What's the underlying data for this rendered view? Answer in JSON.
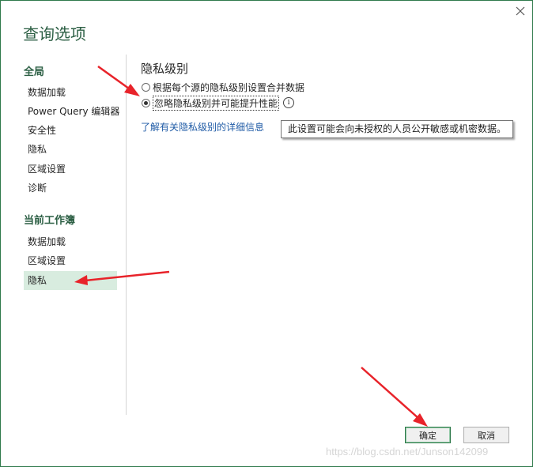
{
  "dialog": {
    "title": "查询选项",
    "close_glyph": "✕"
  },
  "sidebar": {
    "global_header": "全局",
    "global_items": [
      {
        "label": "数据加载"
      },
      {
        "label": "Power Query 编辑器"
      },
      {
        "label": "安全性"
      },
      {
        "label": "隐私"
      },
      {
        "label": "区域设置"
      },
      {
        "label": "诊断"
      }
    ],
    "workbook_header": "当前工作簿",
    "workbook_items": [
      {
        "label": "数据加载"
      },
      {
        "label": "区域设置"
      },
      {
        "label": "隐私",
        "selected": true
      }
    ]
  },
  "content": {
    "heading": "隐私级别",
    "options": [
      {
        "label": "根据每个源的隐私级别设置合并数据",
        "checked": false
      },
      {
        "label": "忽略隐私级别并可能提升性能",
        "checked": true
      }
    ],
    "info_glyph": "i",
    "link": "了解有关隐私级别的详细信息",
    "tooltip": "此设置可能会向未授权的人员公开敏感或机密数据。"
  },
  "footer": {
    "ok_label": "确定",
    "cancel_label": "取消"
  },
  "watermark": "https://blog.csdn.net/Junson142099",
  "colors": {
    "accent_green": "#2c5f44",
    "selected_bg": "#d8ecdf",
    "link_blue": "#1f5ba6",
    "annotation_red": "#e8232a"
  }
}
